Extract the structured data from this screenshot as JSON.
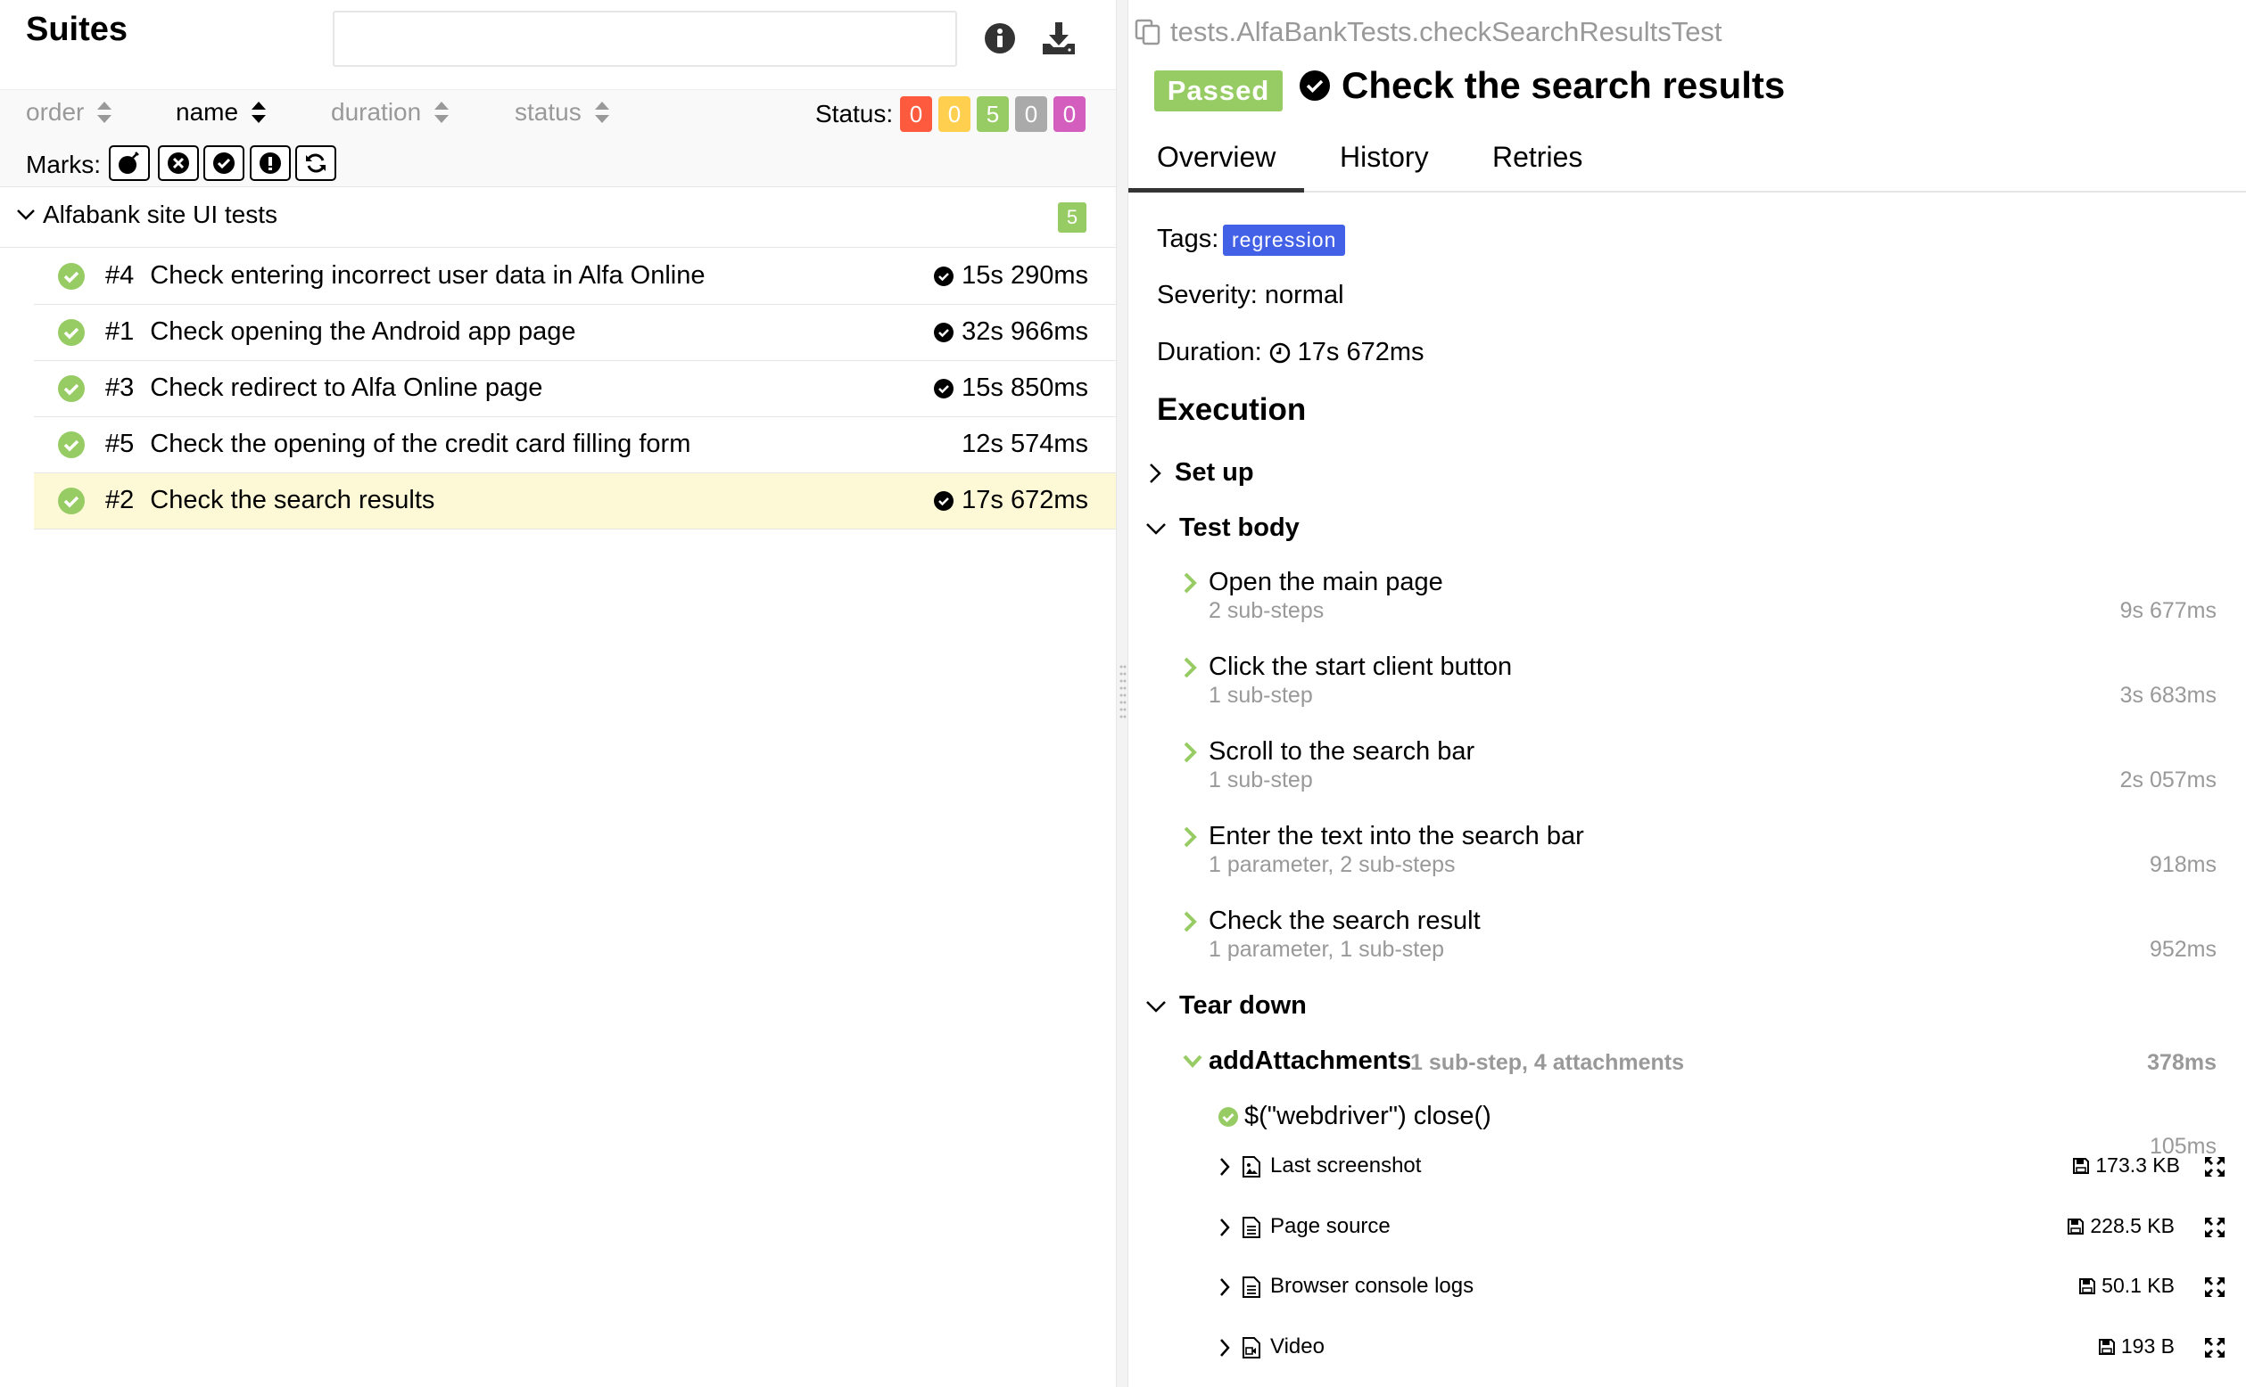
{
  "left": {
    "title": "Suites",
    "search_placeholder": "",
    "sorters": [
      {
        "label": "order"
      },
      {
        "label": "name"
      },
      {
        "label": "duration"
      },
      {
        "label": "status"
      }
    ],
    "status_label": "Status:",
    "status_counts": [
      {
        "value": "0",
        "color": "#fd5a3e"
      },
      {
        "value": "0",
        "color": "#ffd050"
      },
      {
        "value": "5",
        "color": "#97cc64"
      },
      {
        "value": "0",
        "color": "#aaaaaa"
      },
      {
        "value": "0",
        "color": "#d35ebe"
      }
    ],
    "marks_label": "Marks:",
    "group": {
      "name": "Alfabank site UI tests",
      "count": "5"
    },
    "tests": [
      {
        "num": "#4",
        "name": "Check entering incorrect user data in Alfa Online",
        "duration": "15s 290ms",
        "flag": true
      },
      {
        "num": "#1",
        "name": "Check opening the Android app page",
        "duration": "32s 966ms",
        "flag": true
      },
      {
        "num": "#3",
        "name": "Check redirect to Alfa Online page",
        "duration": "15s 850ms",
        "flag": true
      },
      {
        "num": "#5",
        "name": "Check the opening of the credit card filling form",
        "duration": "12s 574ms",
        "flag": false
      },
      {
        "num": "#2",
        "name": "Check the search results",
        "duration": "17s 672ms",
        "flag": true
      }
    ]
  },
  "right": {
    "path": "tests.AlfaBankTests.checkSearchResultsTest",
    "status": "Passed",
    "title": "Check the search results",
    "tabs": [
      "Overview",
      "History",
      "Retries"
    ],
    "tags_label": "Tags:",
    "tag": "regression",
    "severity": "Severity: normal",
    "duration_label": "Duration:",
    "duration": "17s 672ms",
    "execution": "Execution",
    "setup": "Set up",
    "test_body": "Test body",
    "steps": [
      {
        "name": "Open the main page",
        "sub": "2 sub-steps",
        "dur": "9s 677ms"
      },
      {
        "name": "Click the start client button",
        "sub": "1 sub-step",
        "dur": "3s 683ms"
      },
      {
        "name": "Scroll to the search bar",
        "sub": "1 sub-step",
        "dur": "2s 057ms"
      },
      {
        "name": "Enter the text into the search bar",
        "sub": "1 parameter, 2 sub-steps",
        "dur": "918ms"
      },
      {
        "name": "Check the search result",
        "sub": "1 parameter, 1 sub-step",
        "dur": "952ms"
      }
    ],
    "teardown": "Tear down",
    "add_attachments": {
      "name": "addAttachments",
      "sub": "1 sub-step, 4 attachments",
      "dur": "378ms"
    },
    "close_step": {
      "name": "$(\"webdriver\") close()",
      "dur": "105ms"
    },
    "attachments": [
      {
        "name": "Last screenshot",
        "size": "173.3 KB",
        "icon": "image-file-icon"
      },
      {
        "name": "Page source",
        "size": "228.5 KB",
        "icon": "text-file-icon"
      },
      {
        "name": "Browser console logs",
        "size": "50.1 KB",
        "icon": "text-file-icon"
      },
      {
        "name": "Video",
        "size": "193 B",
        "icon": "video-file-icon"
      }
    ],
    "colors": {
      "passed": "#97cc64",
      "tag": "#4361e6",
      "selected_row": "#fdf8d6"
    }
  }
}
